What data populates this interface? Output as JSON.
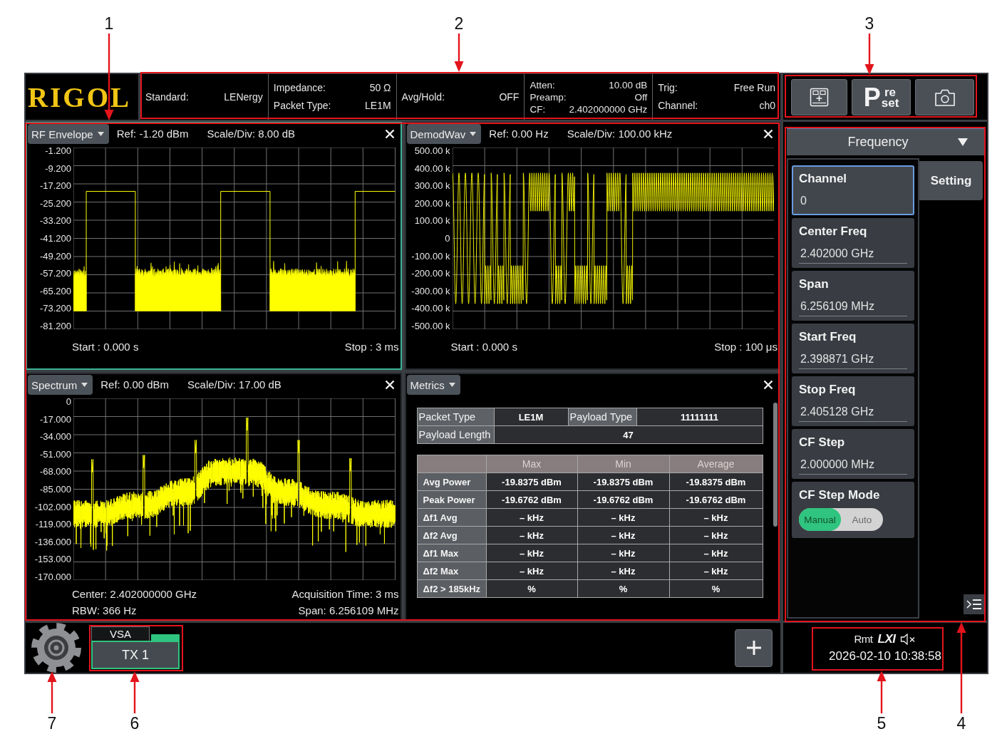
{
  "logo": {
    "text": "RIGOL"
  },
  "info_bar": [
    {
      "items": [
        {
          "label": "Standard:",
          "value": "LENergy"
        }
      ]
    },
    {
      "items": [
        {
          "label": "Impedance:",
          "value": "50 Ω"
        },
        {
          "label": "Packet Type:",
          "value": "LE1M"
        }
      ]
    },
    {
      "items": [
        {
          "label": "Avg/Hold:",
          "value": "OFF"
        }
      ]
    },
    {
      "items": [
        {
          "label": "Atten:",
          "value": "10.00 dB"
        },
        {
          "label": "Preamp:",
          "value": "Off"
        },
        {
          "label": "CF:",
          "value": "2.402000000 GHz"
        }
      ]
    },
    {
      "items": [
        {
          "label": "Trig:",
          "value": "Free Run"
        },
        {
          "label": "Channel:",
          "value": "ch0"
        }
      ]
    }
  ],
  "toolbar": [
    {
      "kind": "view"
    },
    {
      "kind": "preset",
      "label": "P",
      "label_top": "re",
      "label_bottom": "set"
    },
    {
      "kind": "screenshot"
    }
  ],
  "windows": [
    {
      "kind": "envelope",
      "title": "RF Envelope",
      "selected": true,
      "ref": "Ref: -1.20 dBm",
      "scale": "Scale/Div: 8.00 dB",
      "y_labels": [
        "-1.200",
        "-9.200",
        "-17.200",
        "-25.200",
        "-33.200",
        "-41.200",
        "-49.200",
        "-57.200",
        "-65.200",
        "-73.200",
        "-81.200"
      ],
      "footer": [
        {
          "left": "Start : 0.000 s",
          "right": "Stop : 3 ms"
        }
      ]
    },
    {
      "kind": "demod",
      "title": "DemodWav",
      "selected": false,
      "ref": "Ref: 0.00 Hz",
      "scale": "Scale/Div: 100.00 kHz",
      "y_labels": [
        "500.00 k",
        "400.00 k",
        "300.00 k",
        "200.00 k",
        "100.00 k",
        "0",
        "-100.00 k",
        "-200.00 k",
        "-300.00 k",
        "-400.00 k",
        "-500.00 k"
      ],
      "footer": [
        {
          "left": "Start : 0.000 s",
          "right": "Stop : 100 μs"
        }
      ]
    },
    {
      "kind": "spectrum",
      "title": "Spectrum",
      "selected": false,
      "ref": "Ref: 0.00 dBm",
      "scale": "Scale/Div: 17.00 dB",
      "y_labels": [
        "0",
        "-17.000",
        "-34.000",
        "-51.000",
        "-68.000",
        "-85.000",
        "-102.000",
        "-119.000",
        "-136.000",
        "-153.000",
        "-170.000"
      ],
      "footer": [
        {
          "left": "Center: 2.402000000 GHz",
          "right": "Acquisition Time: 3 ms"
        },
        {
          "left": "RBW: 366 Hz",
          "right": "Span: 6.256109 MHz"
        }
      ]
    },
    {
      "kind": "metrics",
      "title": "Metrics",
      "selected": false,
      "summary": [
        {
          "cells": [
            {
              "kind": "label",
              "text": "Packet Type"
            },
            {
              "kind": "value",
              "text": "LE1M"
            },
            {
              "kind": "label",
              "text": "Payload Type"
            },
            {
              "kind": "value",
              "text": "11111111"
            }
          ]
        },
        {
          "cells": [
            {
              "kind": "label",
              "text": "Payload Length"
            },
            {
              "kind": "value",
              "text": "47"
            }
          ]
        }
      ],
      "columns": [
        "Max",
        "Min",
        "Average"
      ],
      "rows": [
        {
          "label": "Avg Power",
          "values": [
            "-19.8375 dBm",
            "-19.8375 dBm",
            "-19.8375 dBm"
          ]
        },
        {
          "label": "Peak Power",
          "values": [
            "-19.6762 dBm",
            "-19.6762 dBm",
            "-19.6762 dBm"
          ]
        },
        {
          "label": "Δf1 Avg",
          "values": [
            "– kHz",
            "– kHz",
            "– kHz"
          ]
        },
        {
          "label": "Δf2 Avg",
          "values": [
            "– kHz",
            "– kHz",
            "– kHz"
          ]
        },
        {
          "label": "Δf1 Max",
          "values": [
            "– kHz",
            "– kHz",
            "– kHz"
          ]
        },
        {
          "label": "Δf2 Max",
          "values": [
            "– kHz",
            "– kHz",
            "– kHz"
          ]
        },
        {
          "label": "Δf2 > 185kHz",
          "values": [
            "%",
            "%",
            "%"
          ]
        }
      ]
    }
  ],
  "settings": {
    "menu": "Frequency",
    "tabs": [
      {
        "label": "Setting",
        "selected": true
      }
    ],
    "items": [
      {
        "kind": "field",
        "label": "Channel",
        "value": "0",
        "selected": true
      },
      {
        "kind": "field",
        "label": "Center Freq",
        "value": "2.402000 GHz",
        "selected": false
      },
      {
        "kind": "field",
        "label": "Span",
        "value": "6.256109 MHz",
        "selected": false
      },
      {
        "kind": "field",
        "label": "Start Freq",
        "value": "2.398871 GHz",
        "selected": false
      },
      {
        "kind": "field",
        "label": "Stop Freq",
        "value": "2.405128 GHz",
        "selected": false
      },
      {
        "kind": "field",
        "label": "CF Step",
        "value": "2.000000 MHz",
        "selected": false
      },
      {
        "kind": "toggle",
        "label": "CF Step Mode",
        "selected": false,
        "options": [
          {
            "label": "Manual",
            "selected": true
          },
          {
            "label": "Auto",
            "selected": false
          }
        ]
      }
    ]
  },
  "instrument_tabs": [
    {
      "mode": "VSA",
      "label": "TX 1",
      "selected": true
    }
  ],
  "status": {
    "remote": "Rmt",
    "lxi": "LXI",
    "muted": true,
    "datetime": "2026-02-10 10:38:58"
  },
  "callouts": [
    {
      "number": "1"
    },
    {
      "number": "2"
    },
    {
      "number": "3"
    },
    {
      "number": "7"
    },
    {
      "number": "6"
    },
    {
      "number": "5"
    },
    {
      "number": "4"
    }
  ]
}
